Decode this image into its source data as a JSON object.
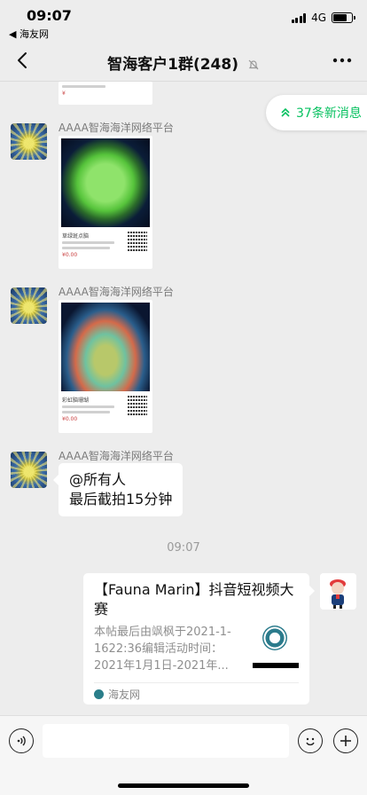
{
  "status_bar": {
    "time": "09:07",
    "back_app": "◀ 海友网",
    "network": "4G"
  },
  "nav": {
    "title": "智海客户1群(248)"
  },
  "new_messages_pill": {
    "label": "37条新消息"
  },
  "messages": [
    {
      "sender": "AAAA智海海洋网络平台",
      "type": "image-card",
      "card_caption": "草绿斑点脑",
      "card_price": "¥0.00"
    },
    {
      "sender": "AAAA智海海洋网络平台",
      "type": "image-card",
      "card_caption": "彩虹脑珊瑚",
      "card_price": "¥0.00"
    },
    {
      "sender": "AAAA智海海洋网络平台",
      "type": "text",
      "line1": "@所有人",
      "line2": "最后截拍15分钟"
    }
  ],
  "time_divider": "09:07",
  "link_card": {
    "title": "【Fauna Marin】抖音短视频大赛",
    "description": "本帖最后由飒枫于2021-1-1622:36编辑活动时间：2021年1月1日-2021年...",
    "source": "海友网"
  },
  "colors": {
    "accent_green": "#07c160",
    "background": "#ededed"
  }
}
